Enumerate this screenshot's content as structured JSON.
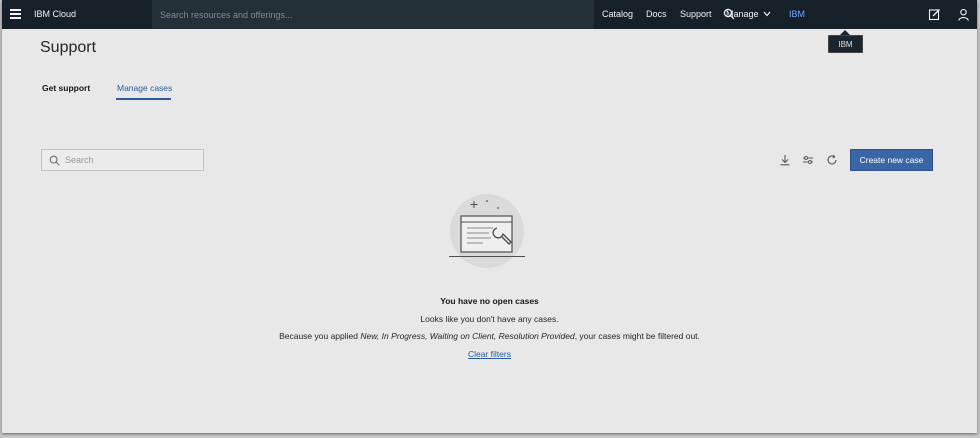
{
  "topbar": {
    "brand": "IBM Cloud",
    "search_placeholder": "Search resources and offerings...",
    "nav": {
      "catalog": "Catalog",
      "docs": "Docs",
      "support": "Support",
      "manage": "Manage",
      "account": "IBM"
    },
    "icons": [
      "menu-icon",
      "search-icon",
      "chevron-down-icon",
      "edit-icon",
      "user-icon"
    ]
  },
  "tooltip": {
    "text": "IBM"
  },
  "page": {
    "title": "Support",
    "tabs": [
      {
        "label": "Get support",
        "active": false
      },
      {
        "label": "Manage cases",
        "active": true
      }
    ]
  },
  "toolbar": {
    "search_placeholder": "Search",
    "create_label": "Create new case",
    "icons": [
      "download-icon",
      "filter-settings-icon",
      "refresh-icon"
    ]
  },
  "empty_state": {
    "title": "You have no open cases",
    "subtitle": "Looks like you don't have any cases.",
    "filter_prefix": "Because you applied ",
    "filter_values": "New, In Progress, Waiting on Client, Resolution Provided",
    "filter_suffix": ", your cases might be filtered out.",
    "clear_label": "Clear filters"
  },
  "colors": {
    "topbar_bg": "#162029",
    "search_bg": "#243038",
    "accent": "#3a66a8",
    "link": "#2c5c9a",
    "page_bg": "#e8e8e8"
  }
}
